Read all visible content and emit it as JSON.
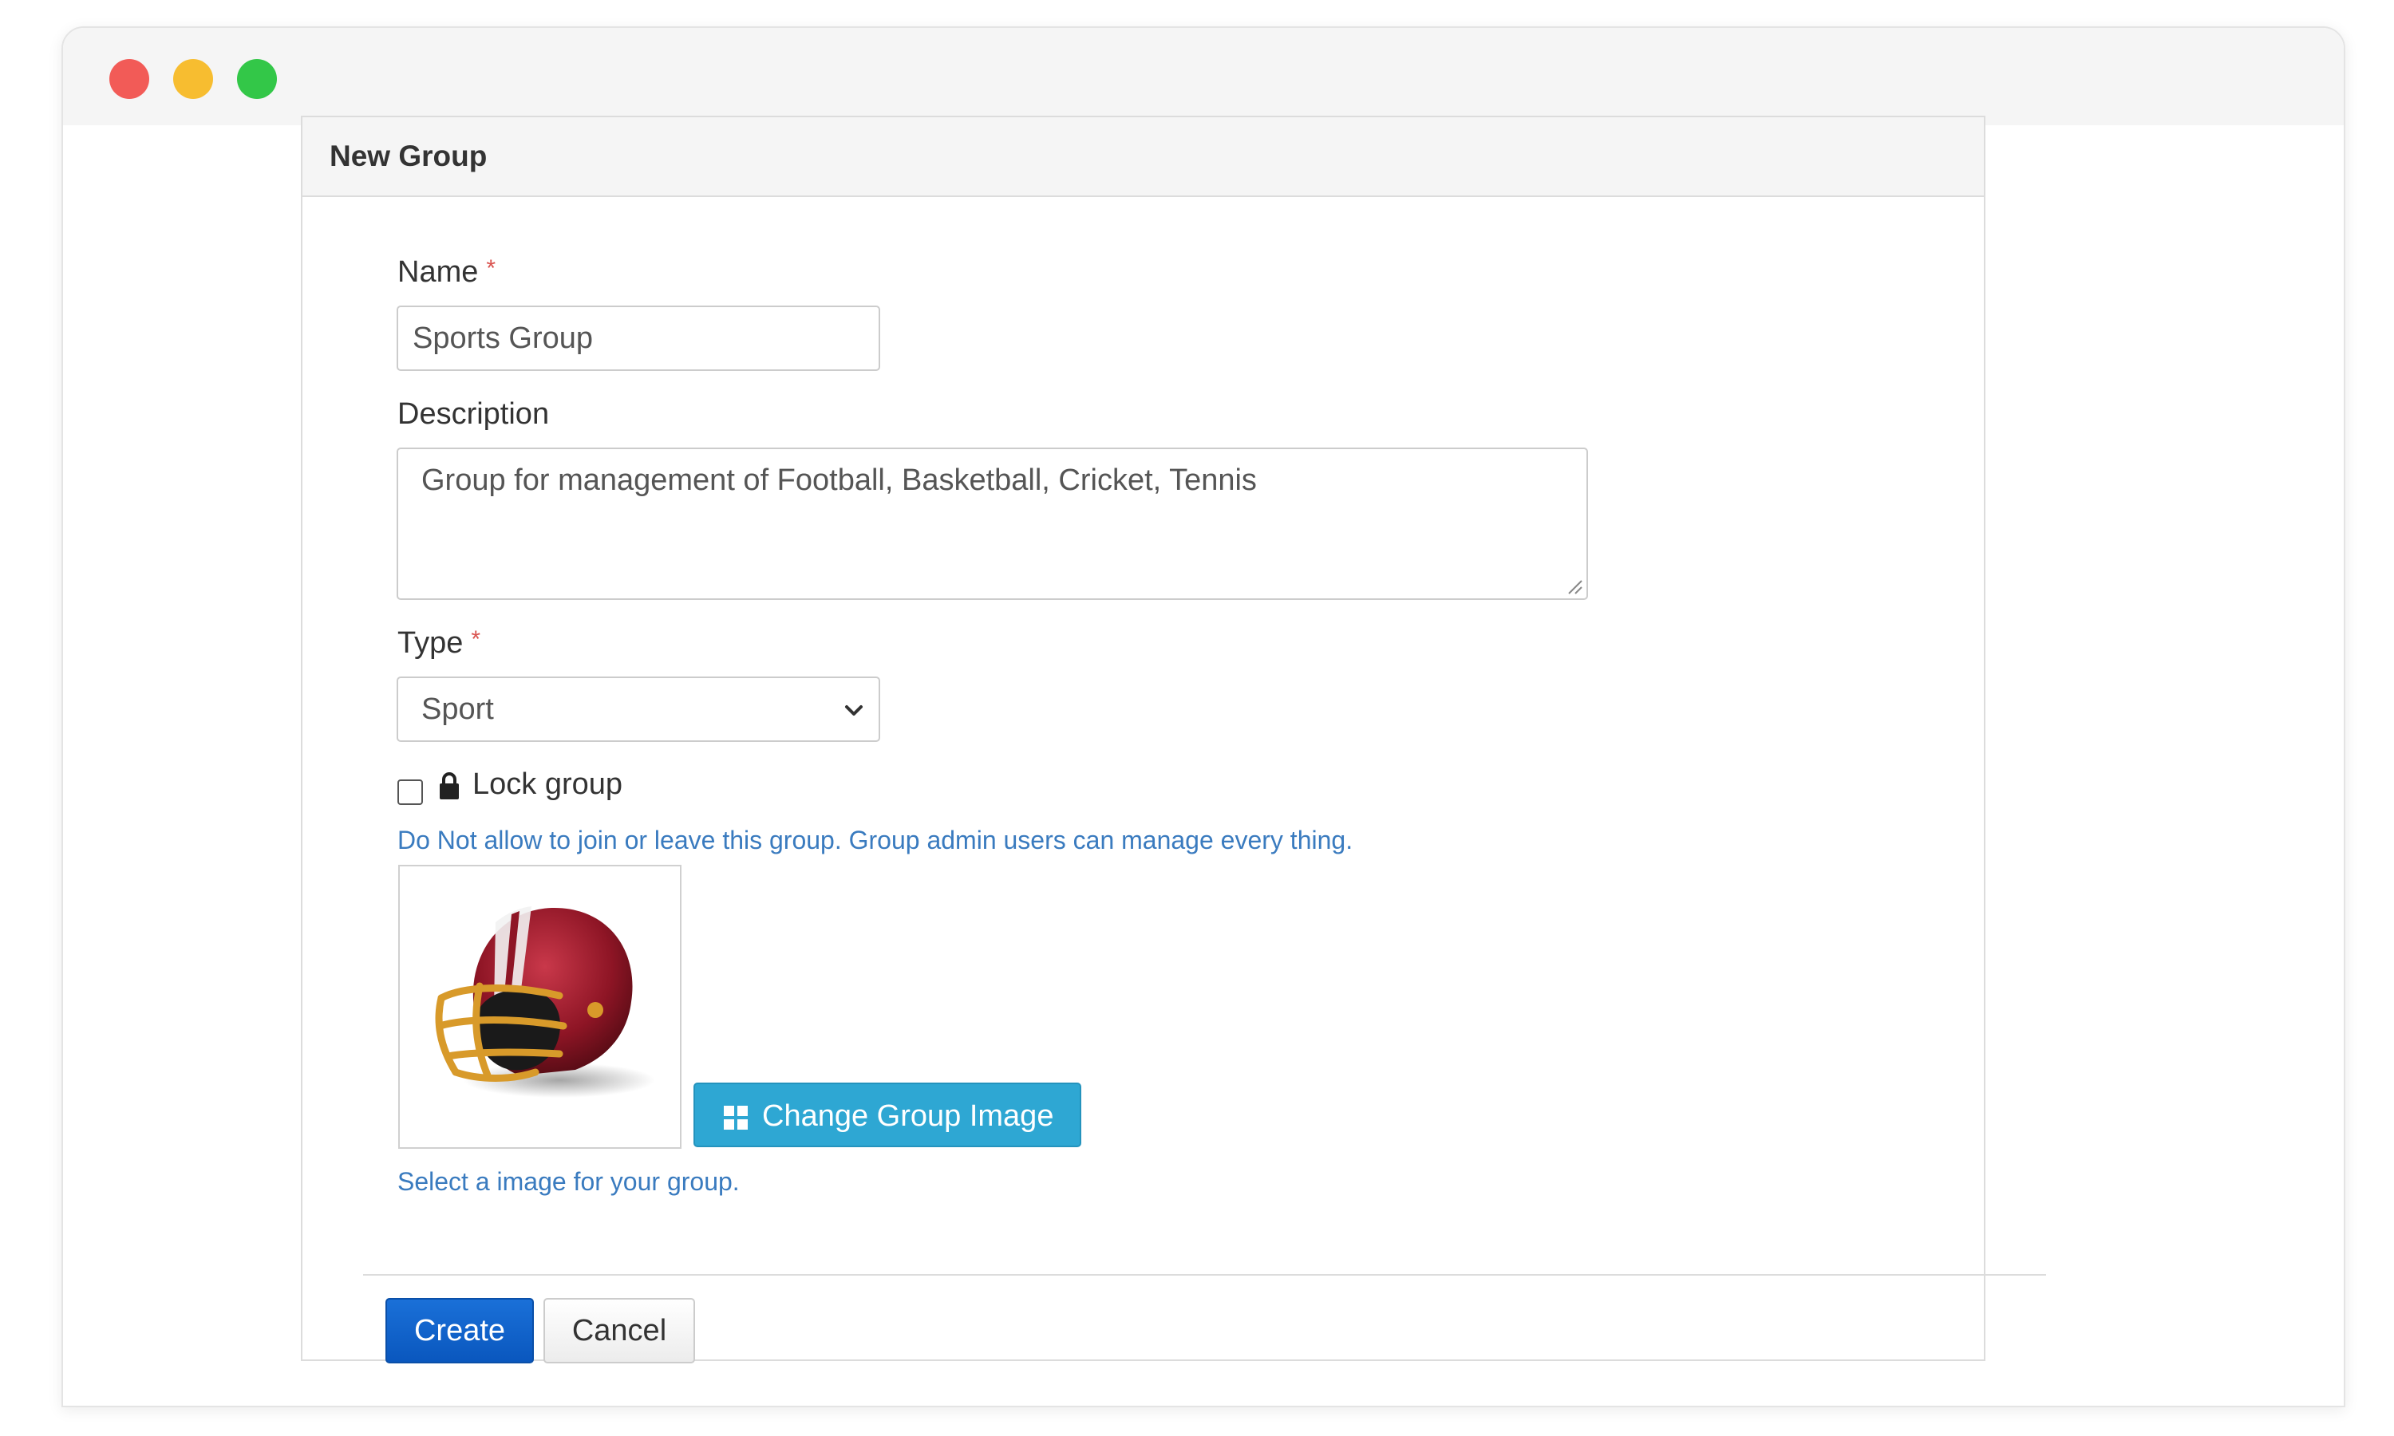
{
  "panel": {
    "title": "New Group"
  },
  "form": {
    "name": {
      "label": "Name",
      "required_mark": "*",
      "value": "Sports Group"
    },
    "description": {
      "label": "Description",
      "value": "Group for management of Football, Basketball, Cricket, Tennis"
    },
    "type": {
      "label": "Type",
      "required_mark": "*",
      "selected": "Sport"
    },
    "lock": {
      "label": "Lock group",
      "checked": false,
      "help": "Do Not allow to join or leave this group. Group admin users can manage every thing."
    },
    "image": {
      "button_label": "Change Group Image",
      "help": "Select a image for your group."
    }
  },
  "actions": {
    "create_label": "Create",
    "cancel_label": "Cancel"
  },
  "colors": {
    "primary": "#0a57be",
    "info": "#2ea7d3",
    "help_text": "#3a7bbf",
    "required": "#d9534f"
  },
  "icons": {
    "lock": "lock-icon",
    "change_image": "grid-icon",
    "select": "chevron-down-icon",
    "group_image": "football-helmet-image"
  }
}
